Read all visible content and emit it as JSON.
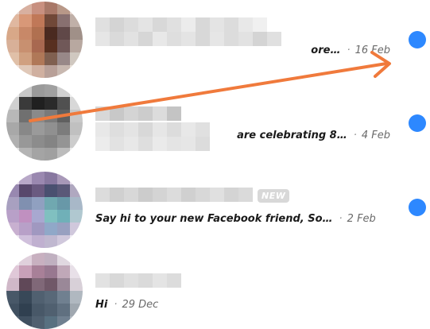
{
  "conversations": [
    {
      "preview": "ore…",
      "separator": "·",
      "date": "16 Feb",
      "unread": true
    },
    {
      "preview": "are celebrating 8…",
      "separator": "·",
      "date": "4 Feb",
      "unread": true
    },
    {
      "preview": "Say hi to your new Facebook friend, So…",
      "separator": "·",
      "date": "2 Feb",
      "badge": "NEW",
      "unread": true
    },
    {
      "preview": "Hi",
      "separator": "·",
      "date": "29 Dec",
      "unread": false
    }
  ],
  "colors": {
    "unread_dot": "#2d88ff",
    "annotation_arrow": "#f07a3c",
    "badge_bg": "#d8d8d8"
  },
  "icons": [
    "unread-dot-icon",
    "annotation-arrow-icon"
  ]
}
